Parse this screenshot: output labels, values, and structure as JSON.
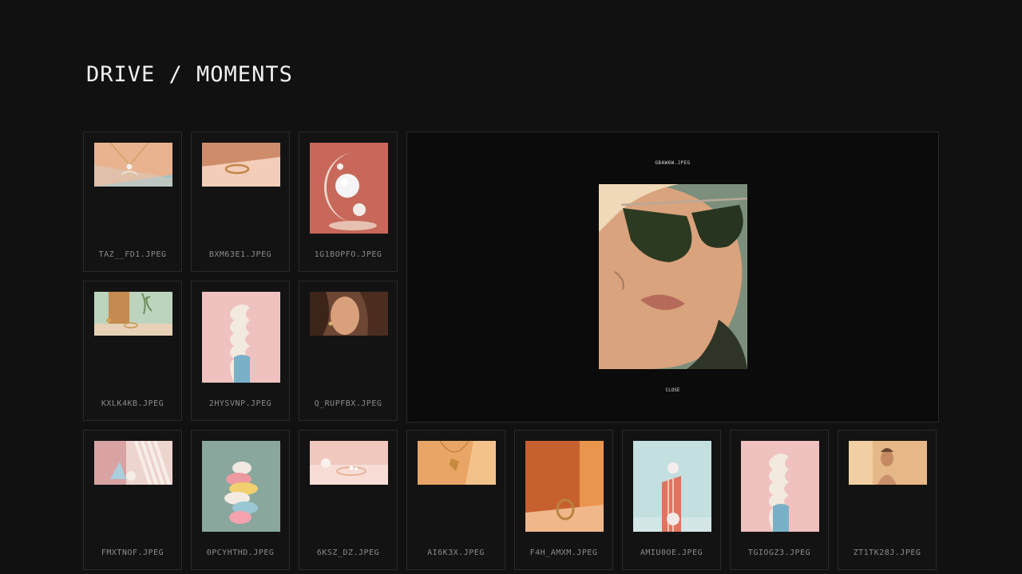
{
  "header": {
    "title": "DRIVE / MOMENTS"
  },
  "viewer": {
    "filename": "GBAW6W.JPEG",
    "close_label": "CLOSE"
  },
  "files": [
    {
      "name": "TAZ__FD1.JPEG",
      "icon": "pendant-necklace-photo"
    },
    {
      "name": "BXM63E1.JPEG",
      "icon": "gold-ring-photo"
    },
    {
      "name": "1G1BOPFO.JPEG",
      "icon": "pearl-sculpture-photo"
    },
    {
      "name": "KXLK4KB.JPEG",
      "icon": "plant-ring-photo"
    },
    {
      "name": "2HYSVNP.JPEG",
      "icon": "twisted-column-photo"
    },
    {
      "name": "Q_RUPFBX.JPEG",
      "icon": "woman-portrait-photo"
    },
    {
      "name": "FMXTNOF.JPEG",
      "icon": "abstract-shapes-photo"
    },
    {
      "name": "0PCYHTHD.JPEG",
      "icon": "stacked-rings-photo"
    },
    {
      "name": "6KSZ_DZ.JPEG",
      "icon": "pearl-tray-photo"
    },
    {
      "name": "AI6K3X.JPEG",
      "icon": "gold-necklace-photo"
    },
    {
      "name": "F4H_AMXM.JPEG",
      "icon": "ring-shadow-photo"
    },
    {
      "name": "AMIU0OE.JPEG",
      "icon": "pillar-sphere-photo"
    },
    {
      "name": "TGIOGZ3.JPEG",
      "icon": "twisted-column-photo"
    },
    {
      "name": "ZT1TK28J.JPEG",
      "icon": "woman-sunlight-photo"
    }
  ]
}
